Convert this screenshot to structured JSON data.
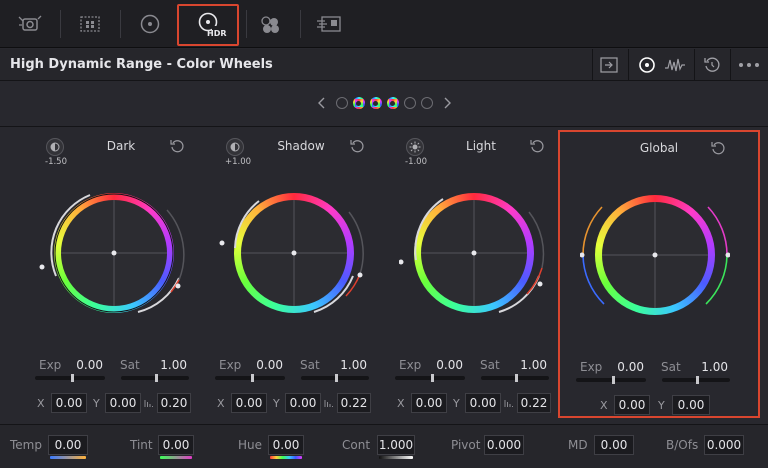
{
  "toolbar": {
    "icons": [
      "camera-raw-icon",
      "color-match-icon",
      "primaries-wheel-icon",
      "hdr-wheel-icon",
      "rgb-mixer-icon",
      "motion-effects-icon"
    ],
    "hdr_label": "HDR"
  },
  "title": "High Dynamic Range - Color Wheels",
  "panels": [
    {
      "name": "Dark",
      "zone": "-1.50",
      "exp": "0.00",
      "sat": "1.00",
      "x": "0.00",
      "y": "0.00",
      "z": "0.20"
    },
    {
      "name": "Shadow",
      "zone": "+1.00",
      "exp": "0.00",
      "sat": "1.00",
      "x": "0.00",
      "y": "0.00",
      "z": "0.22"
    },
    {
      "name": "Light",
      "zone": "-1.00",
      "exp": "0.00",
      "sat": "1.00",
      "x": "0.00",
      "y": "0.00",
      "z": "0.22"
    },
    {
      "name": "Global",
      "exp": "0.00",
      "sat": "1.00",
      "x": "0.00",
      "y": "0.00"
    }
  ],
  "labels": {
    "exp": "Exp",
    "sat": "Sat",
    "x": "X",
    "y": "Y"
  },
  "bottom": {
    "temp": {
      "label": "Temp",
      "value": "0.00"
    },
    "tint": {
      "label": "Tint",
      "value": "0.00"
    },
    "hue": {
      "label": "Hue",
      "value": "0.00"
    },
    "cont": {
      "label": "Cont",
      "value": "1.000"
    },
    "pivot": {
      "label": "Pivot",
      "value": "0.000"
    },
    "md": {
      "label": "MD",
      "value": "0.00"
    },
    "bofs": {
      "label": "B/Ofs",
      "value": "0.000"
    }
  },
  "colors": {
    "accent": "#d9462f",
    "background": "#28282e"
  }
}
